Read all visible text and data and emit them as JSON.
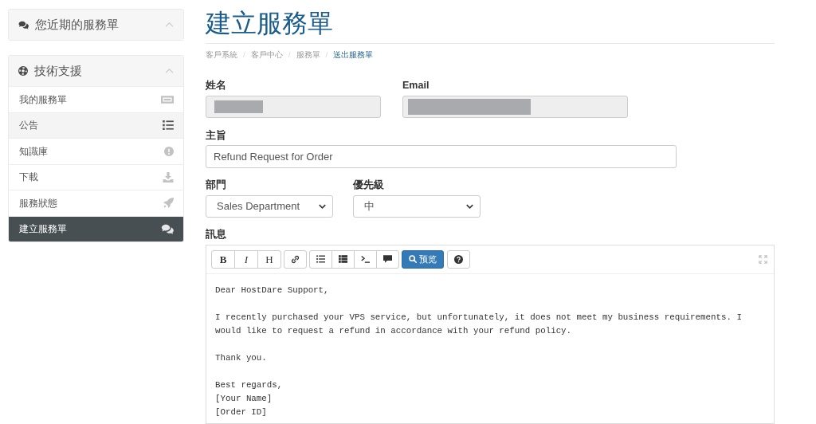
{
  "sidebar": {
    "panels": [
      {
        "title": "您近期的服務單"
      },
      {
        "title": "技術支援",
        "items": [
          {
            "label": "我的服務單",
            "selected": false,
            "hovered": false
          },
          {
            "label": "公告",
            "selected": false,
            "hovered": true
          },
          {
            "label": "知識庫",
            "selected": false,
            "hovered": false
          },
          {
            "label": "下載",
            "selected": false,
            "hovered": false
          },
          {
            "label": "服務狀態",
            "selected": false,
            "hovered": false
          },
          {
            "label": "建立服務單",
            "selected": true,
            "hovered": false
          }
        ]
      }
    ]
  },
  "page": {
    "title": "建立服務單",
    "breadcrumb": [
      {
        "label": "客戶系統",
        "separator": "/",
        "active": false
      },
      {
        "label": "客戶中心",
        "separator": "/",
        "active": false
      },
      {
        "label": "服務單",
        "separator": "/",
        "active": false
      },
      {
        "label": "送出服務單",
        "active": true
      }
    ]
  },
  "form": {
    "name": {
      "label": "姓名",
      "disabled": true,
      "redacted": true
    },
    "email": {
      "label": "Email",
      "disabled": true,
      "redacted": true
    },
    "subject": {
      "label": "主旨",
      "value": "Refund Request for Order"
    },
    "department": {
      "label": "部門",
      "value": "Sales Department"
    },
    "priority": {
      "label": "優先級",
      "value": "中"
    },
    "message": {
      "label": "訊息",
      "format_buttons": [
        "B",
        "I",
        "H"
      ],
      "preview_button": "预览",
      "text": "Dear HostDare Support,\n\nI recently purchased your VPS service, but unfortunately, it does not meet my business requirements. I would like to request a refund in accordance with your refund policy.\n\nThank you.\n\nBest regards,\n[Your Name]\n[Order ID]"
    }
  }
}
